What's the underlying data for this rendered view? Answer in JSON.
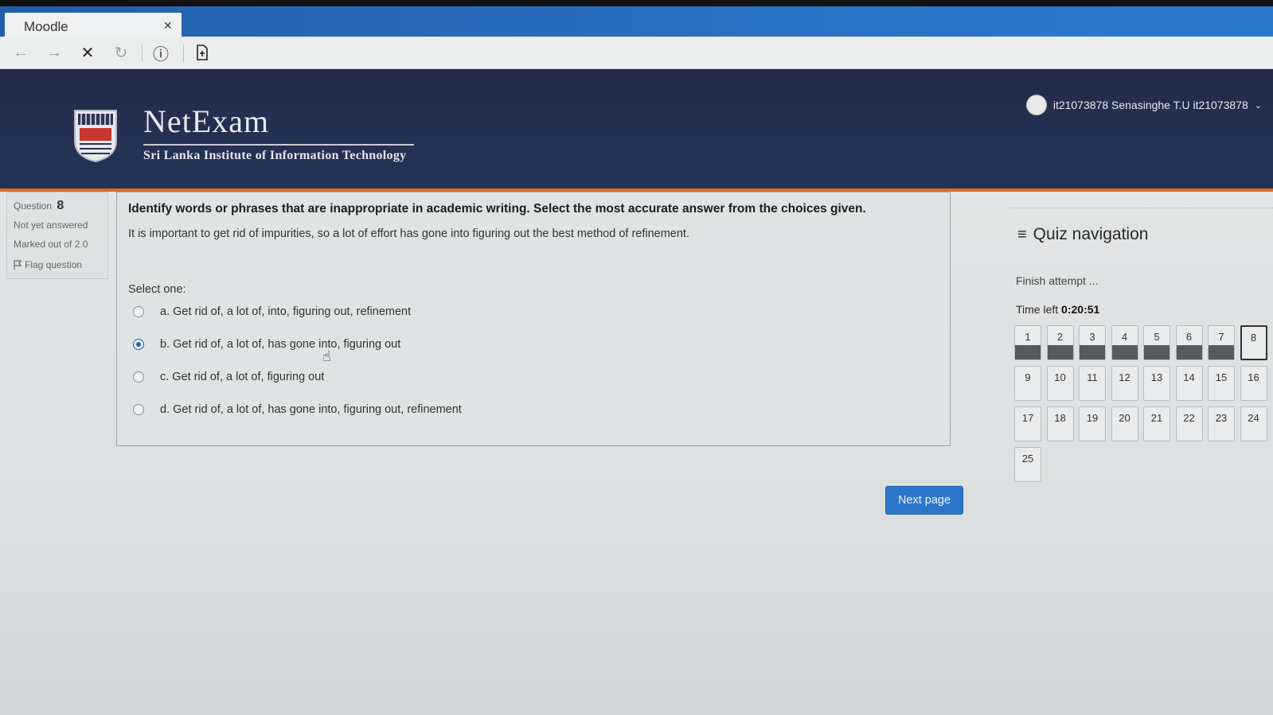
{
  "browser": {
    "tab_title": "Moodle",
    "tab_close": "×",
    "toolbar": {
      "back_icon": "←",
      "forward_icon": "→",
      "stop_icon": "✕",
      "reload_icon": "↻",
      "info_icon": "ⓘ",
      "page_icon": "🗋"
    }
  },
  "header": {
    "brand_title": "NetExam",
    "brand_subtitle": "Sri Lanka Institute of Information Technology",
    "user_name": "it21073878 Senasinghe T.U it21073878",
    "user_caret": "⌄",
    "accent_color": "#e06a1b"
  },
  "question_info": {
    "label": "Question",
    "number": "8",
    "status": "Not yet answered",
    "marks": "Marked out of 2.0",
    "flag_label": "Flag question"
  },
  "question": {
    "prompt": "Identify words or phrases that are inappropriate in academic writing. Select the most accurate answer from the choices given.",
    "sentence": "It is important to get rid of impurities, so a lot of effort has gone into figuring out the best method of refinement.",
    "select_label": "Select one:",
    "options": [
      {
        "label": "a. Get rid of, a lot of, into, figuring out, refinement",
        "checked": false
      },
      {
        "label": "b. Get rid of, a lot of, has gone into, figuring out",
        "checked": true
      },
      {
        "label": "c. Get rid of, a lot of, figuring out",
        "checked": false
      },
      {
        "label": "d. Get rid of, a lot of, has gone into, figuring out, refinement",
        "checked": false
      }
    ]
  },
  "next_button": "Next page",
  "quiz_nav": {
    "title": "Quiz navigation",
    "menu_icon": "≡",
    "finish_link": "Finish attempt ...",
    "time_left_label": "Time left",
    "time_left_value": "0:20:51",
    "current": 8,
    "answered": [
      1,
      2,
      3,
      4,
      5,
      6,
      7
    ],
    "questions": [
      "1",
      "2",
      "3",
      "4",
      "5",
      "6",
      "7",
      "8",
      "9",
      "10",
      "11",
      "12",
      "13",
      "14",
      "15",
      "16",
      "17",
      "18",
      "19",
      "20",
      "21",
      "22",
      "23",
      "24",
      "25"
    ]
  }
}
